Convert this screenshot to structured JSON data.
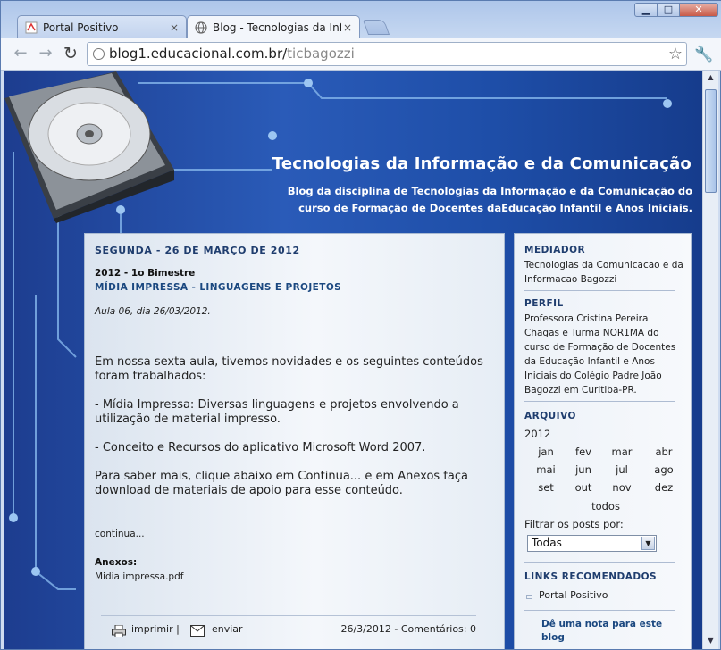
{
  "browser": {
    "tabs": [
      {
        "label": "Portal Positivo",
        "active": false
      },
      {
        "label": "Blog - Tecnologias da Infor",
        "active": true
      }
    ],
    "close_glyph": "×",
    "address": {
      "host": "blog1.educacional.com.br/",
      "path": "ticbagozzi"
    },
    "icons": [
      "back-icon",
      "forward-icon",
      "reload-icon",
      "globe-icon",
      "star-icon",
      "wrench-icon"
    ]
  },
  "blog": {
    "title": "Tecnologias da Informação e da Comunicação",
    "description": "Blog da disciplina de Tecnologias da Informação e da Comunicação do curso de Formação de Docentes daEducação Infantil e Anos Iniciais."
  },
  "post": {
    "date": "SEGUNDA - 26 DE MARÇO DE 2012",
    "term": "2012 - 1o Bimestre",
    "title": "MÍDIA IMPRESSA - LINGUAGENS E PROJETOS",
    "meta": "Aula 06, dia 26/03/2012.",
    "paragraphs": [
      "Em nossa sexta aula, tivemos novidades e os seguintes conteúdos foram trabalhados:",
      "- Mídia Impressa: Diversas linguagens e projetos envolvendo a utilização de material impresso.",
      "- Conceito e Recursos do aplicativo Microsoft Word 2007.",
      "Para saber mais, clique abaixo em Continua... e em Anexos faça download de materiais de apoio para esse conteúdo."
    ],
    "continue": "continua...",
    "attachments_label": "Anexos:",
    "attachment": "Midia impressa.pdf",
    "footer": {
      "print": "imprimir |",
      "send": "enviar",
      "stats": "26/3/2012 - Comentários: 0"
    }
  },
  "sidebar": {
    "mediator": {
      "heading": "MEDIADOR",
      "text": "Tecnologias da Comunicacao e da Informacao Bagozzi"
    },
    "profile": {
      "heading": "PERFIL",
      "text": "Professora Cristina Pereira Chagas e Turma NOR1MA do curso de Formação de Docentes da Educação Infantil e Anos Iniciais do Colégio Padre João Bagozzi em Curitiba-PR."
    },
    "archive": {
      "heading": "ARQUIVO",
      "year": "2012",
      "months": [
        "jan",
        "fev",
        "mar",
        "abr",
        "mai",
        "jun",
        "jul",
        "ago",
        "set",
        "out",
        "nov",
        "dez"
      ],
      "all": "todos",
      "filter_label": "Filtrar os posts por:",
      "filter_value": "Todas"
    },
    "links": {
      "heading": "LINKS RECOMENDADOS",
      "item": "Portal Positivo"
    },
    "rate": "Dê uma nota para este blog"
  },
  "colors": {
    "page_blue": "#1e4ea8",
    "heading_blue": "#1f3d6e",
    "link_blue": "#1b4880"
  }
}
